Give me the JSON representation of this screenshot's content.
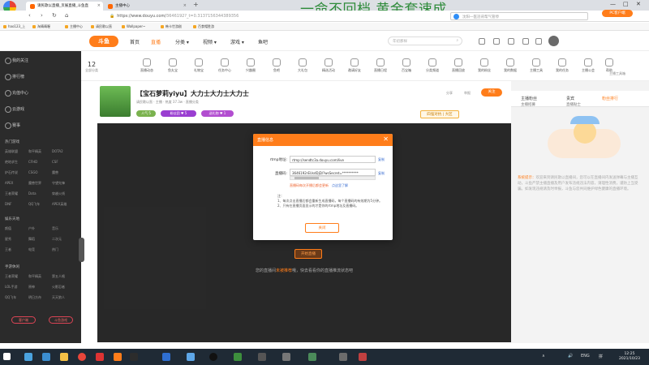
{
  "browser": {
    "tabs": [
      {
        "title": "请民歌以直播_页展直播_斗鱼直",
        "active": true
      },
      {
        "title": "主播中心",
        "active": false
      }
    ],
    "new_tab": "+",
    "overlay_title": "一命不回档,黄金套速成",
    "url_secure": "https://www.douyu.com/",
    "url_rest": "3646192?_t=0.3137156344389356",
    "search_placeholder": "沈阳一医违背帮气管停",
    "bookmarks": [
      "hao123_上",
      "淘晴晴喔",
      "主播中心",
      "请民歌以直",
      "Wallpaper~",
      "韩卡世游剧",
      "百食帽胜游"
    ],
    "window_controls": [
      "—",
      "□",
      "✕"
    ]
  },
  "site": {
    "logo": "斗鱼",
    "nav": [
      {
        "label": "首页",
        "active": false
      },
      {
        "label": "直播",
        "active": true
      },
      {
        "label": "分类 ▾",
        "active": false
      },
      {
        "label": "视频 ▾",
        "active": false
      },
      {
        "label": "游戏 ▾",
        "active": false
      },
      {
        "label": "鱼吧",
        "active": false
      }
    ],
    "search_placeholder": "年初那样"
  },
  "sidebar": {
    "items": [
      "我的关注",
      "排行榜",
      "充值中心",
      "云游戏",
      "赛事"
    ],
    "section1_title": "热门游戏",
    "section1_grid": [
      "英雄联盟",
      "和平精英",
      "DOTA2",
      "绝地求生",
      "CFHD",
      "CSF",
      "炉石传说",
      "CSGO",
      "魔兽",
      "APEX",
      "魔兽世界",
      "守望先锋",
      "王者荣耀",
      "Dota",
      "穿越火线",
      "DNF",
      "QQ飞车",
      "APEX英雄"
    ],
    "section2_title": "娱乐天地",
    "section2_grid": [
      "颜值",
      "户外",
      "音乐",
      "星秀",
      "舞蹈",
      "二次元",
      "王者",
      "电竞",
      "热门"
    ],
    "section3_title": "手游休闲",
    "section3_grid": [
      "王者荣耀",
      "和平精英",
      "第五人格",
      "LOL手游",
      "原神",
      "火影忍者",
      "QQ飞车",
      "明日方舟",
      "天天狼人"
    ],
    "buttons": [
      "客户端",
      "斗鱼游戏"
    ]
  },
  "categories": {
    "first_value": "12",
    "first_label": "全部分类",
    "items": [
      "直播动态",
      "鱼丸宝",
      "礼物宝",
      "任务中心",
      "兴趣圈",
      "鱼吧",
      "大礼包",
      "精选活动",
      "邀请好友",
      "直播日程",
      "百宝箱",
      "分类频道",
      "直播回放",
      "我的粉丝",
      "我的数据",
      "主播工具",
      "我的任务",
      "主播公会",
      "帮助"
    ],
    "pc_client": "PC客户端",
    "pc_client_sub": "主播工具箱"
  },
  "room": {
    "title": "【宝石萝莉yiyu】大力士大力士大力士",
    "meta": "请民歌以直 · 主播 · 热度 37.3w · 直播分类",
    "tags": [
      "人气 5",
      "粉丝团 ♥ 5",
      "送礼物 ♥ 1"
    ],
    "rank_badge": "四强对抗 | 大区",
    "small_btns": [
      "分享",
      "举报"
    ],
    "follow": "关注"
  },
  "player": {
    "start_live": "开始直播",
    "notice_pre": "您的直播间",
    "notice_link": "未被推荐",
    "notice_post": "哦，快去看看你的直播推流状态吧"
  },
  "rightpanel": {
    "tabs": [
      "主播粉丝",
      "贵宾",
      "粉丝排行"
    ],
    "subs": [
      "主播招募",
      "直播贴士"
    ],
    "notice_key": "系统提示：",
    "notice_text": "欢迎来到请民歌以直播间，您可以在直播间内发送弹幕与主播互动，斗鱼严禁主播直播及用户发布违规违法内容，请理性消费，谨防上当受骗。如发现违规请及时举报，斗鱼与您共同维护绿色健康的直播环境。"
  },
  "modal": {
    "title": "直播信息",
    "close": "✕",
    "rtmp_label": "rtmp地址:",
    "rtmp_value": "rtmp://sendtc3a.douyu.com/live",
    "key_label": "直播码:",
    "key_value": "3646192rEUsdDjD/?wsSecret=**********",
    "copy": "复制",
    "warn": "直播码每次开播后都会更新",
    "warn_link": "点这里了解",
    "notes_title": "注：",
    "notes": [
      "1、每次点击直播后都会重新生成直播码，每个直播码的有效期为5分钟。",
      "2、只有在直播页面显示的才是你的rtmp地址及直播码。"
    ],
    "ok": "关闭"
  },
  "taskbar": {
    "tray": [
      "∧",
      "🔊",
      "ENG",
      "拼"
    ],
    "time": "12:25",
    "date": "2021/10/23"
  }
}
